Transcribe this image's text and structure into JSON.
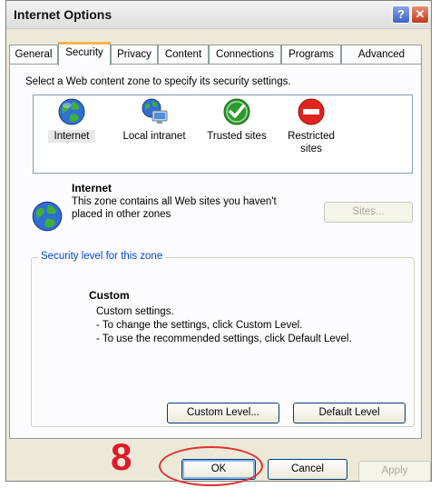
{
  "window": {
    "title": "Internet Options"
  },
  "titlebar_buttons": {
    "help": "?",
    "close": "✕"
  },
  "tabs": [
    {
      "label": "General"
    },
    {
      "label": "Security",
      "active": true
    },
    {
      "label": "Privacy"
    },
    {
      "label": "Content"
    },
    {
      "label": "Connections"
    },
    {
      "label": "Programs"
    },
    {
      "label": "Advanced"
    }
  ],
  "security": {
    "instruction": "Select a Web content zone to specify its security settings.",
    "zones": [
      {
        "label": "Internet",
        "icon": "globe-icon",
        "selected": true
      },
      {
        "label": "Local intranet",
        "icon": "network-globe-icon"
      },
      {
        "label": "Trusted sites",
        "icon": "checkmark-icon"
      },
      {
        "label": "Restricted sites",
        "icon": "no-entry-icon"
      }
    ],
    "zone_info": {
      "title": "Internet",
      "description": "This zone contains all Web sites you haven't placed in other zones"
    },
    "sites_button": "Sites...",
    "security_level_legend": "Security level for this zone",
    "level": {
      "title": "Custom",
      "lines": [
        "Custom settings.",
        "- To change the settings, click Custom Level.",
        "- To use the recommended settings, click Default Level."
      ]
    },
    "custom_level_button": "Custom Level...",
    "default_level_button": "Default Level"
  },
  "footer": {
    "ok": "OK",
    "cancel": "Cancel",
    "apply": "Apply"
  },
  "annotation": {
    "step_number": "8"
  },
  "colors": {
    "dialog_bg": "#ECE9D8",
    "tab_highlight": "#F7B54A",
    "legend_text": "#0046D5",
    "annotation_red": "#E0192B"
  }
}
